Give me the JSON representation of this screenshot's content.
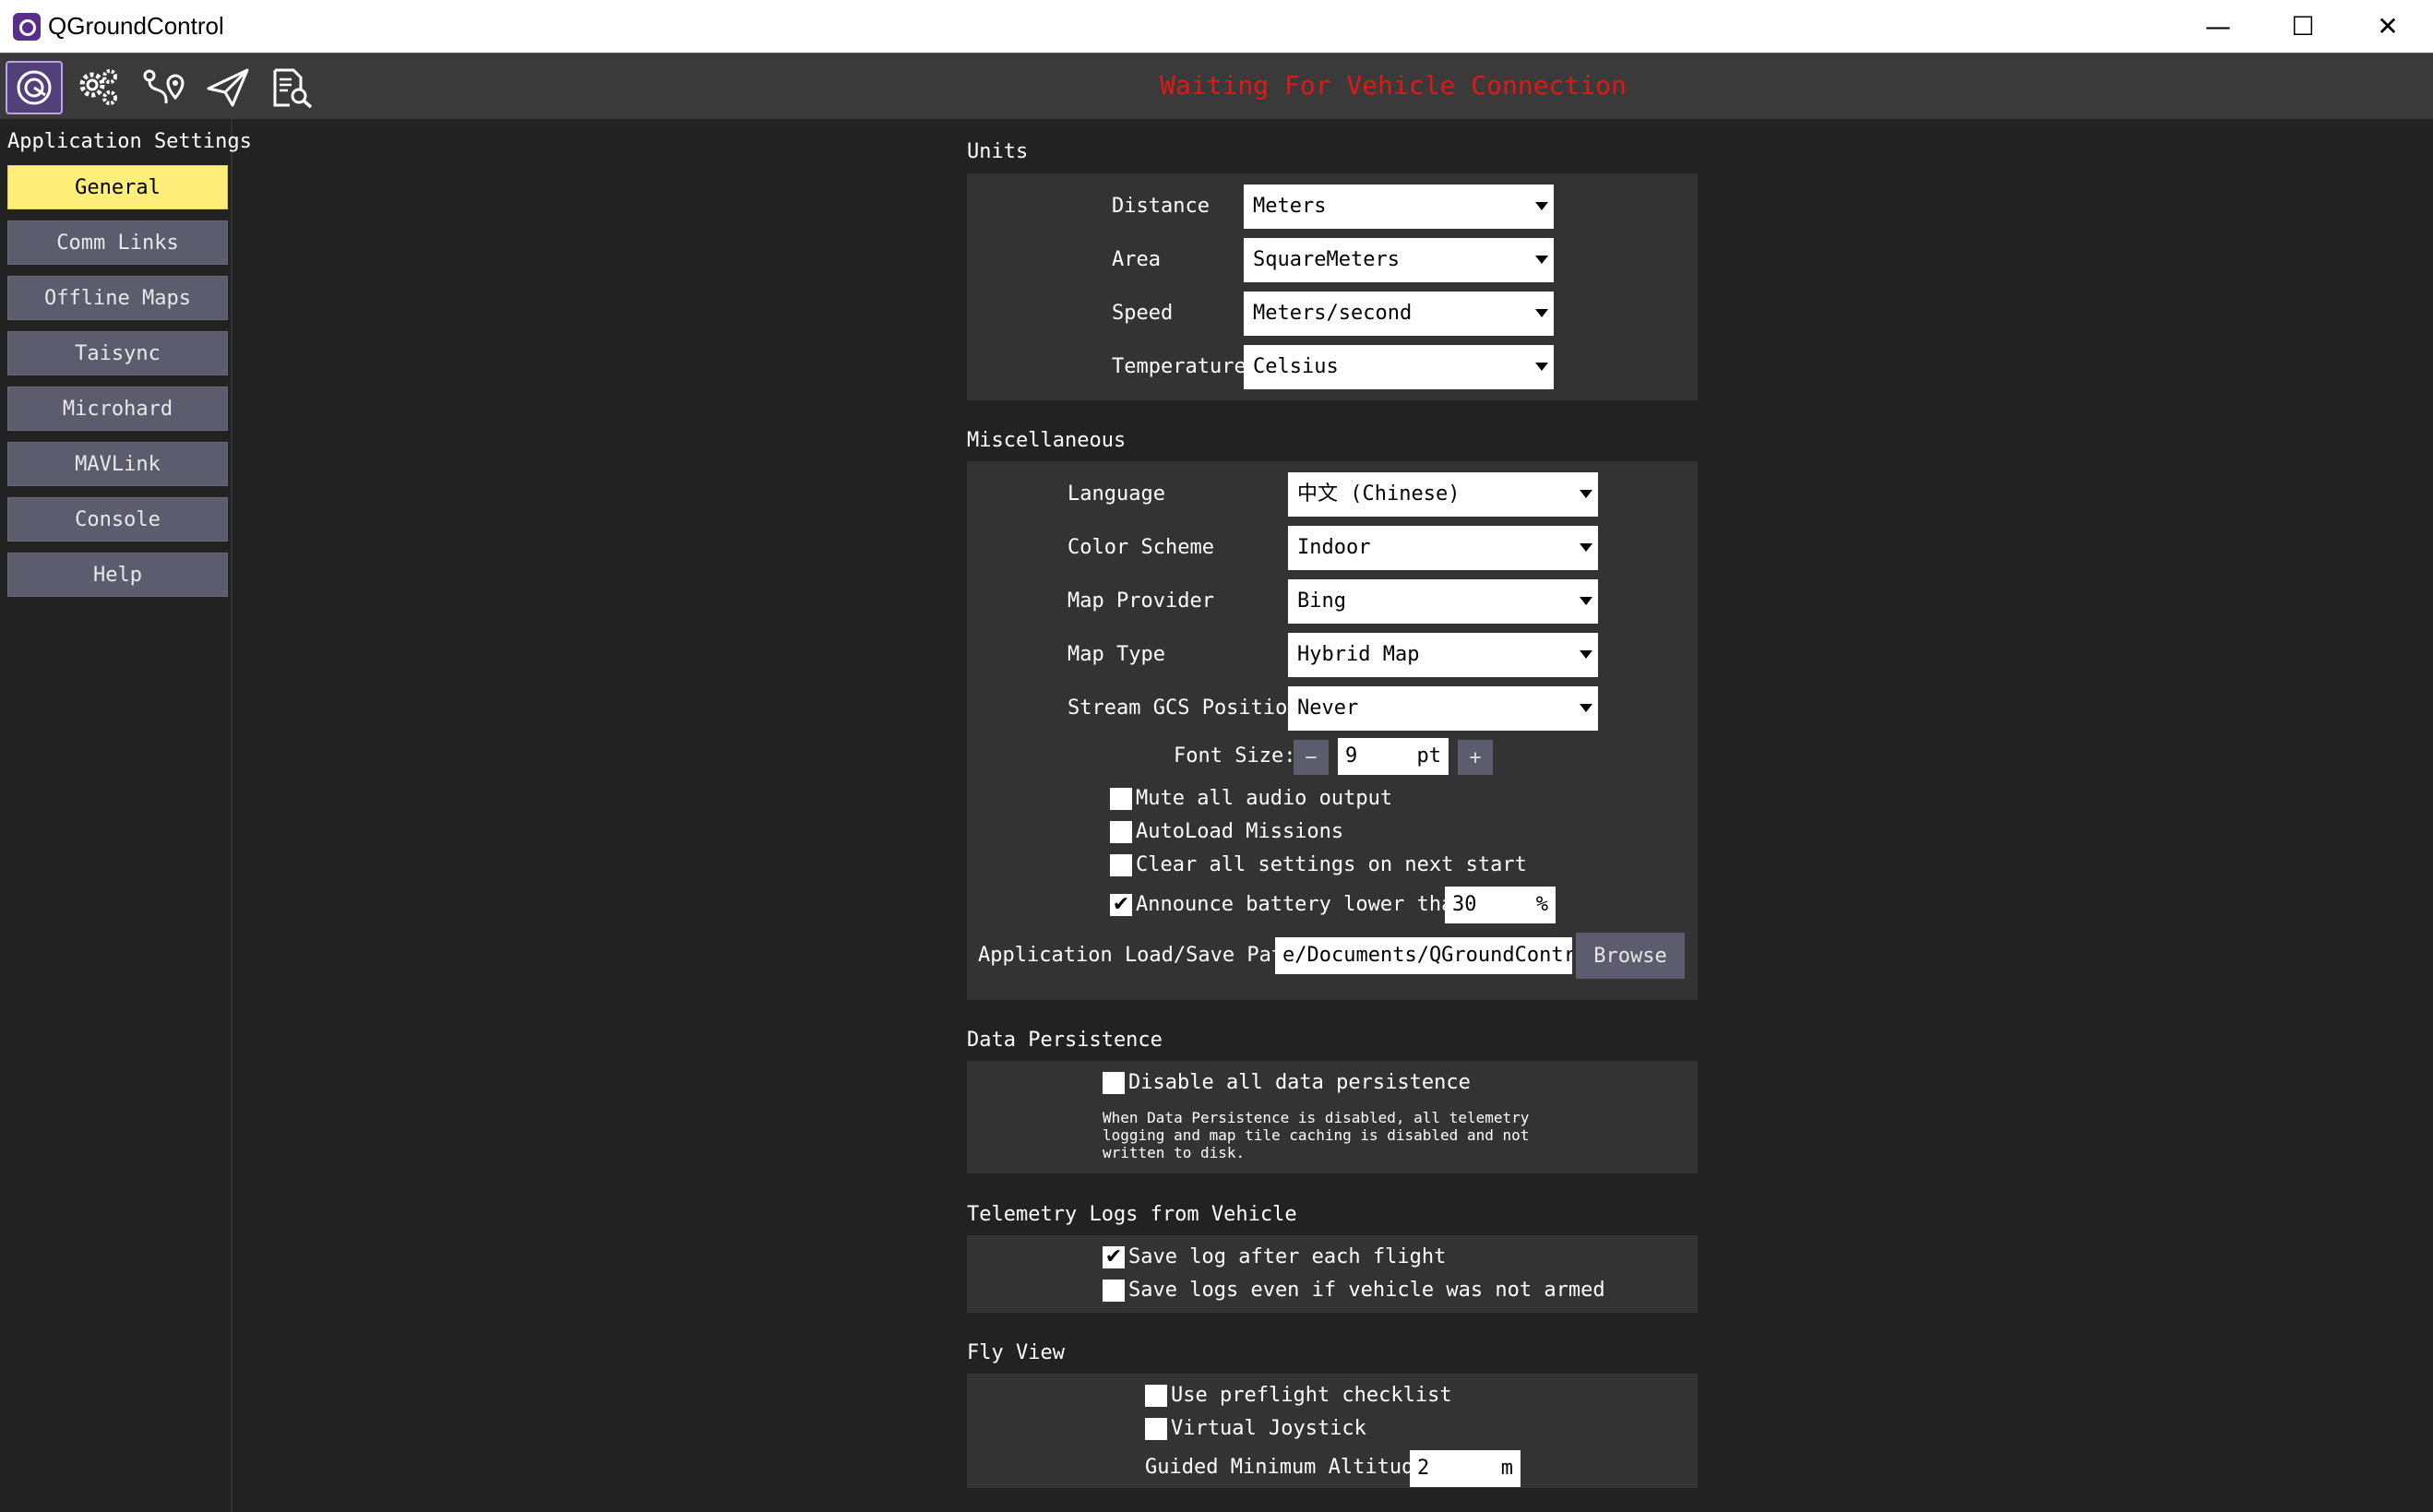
{
  "window": {
    "title": "QGroundControl",
    "minimize": "—",
    "maximize": "☐",
    "close": "✕"
  },
  "toolbar": {
    "status": "Waiting For Vehicle Connection"
  },
  "sidebar": {
    "title": "Application Settings",
    "items": [
      "General",
      "Comm Links",
      "Offline Maps",
      "Taisync",
      "Microhard",
      "MAVLink",
      "Console",
      "Help"
    ]
  },
  "units": {
    "header": "Units",
    "rows": [
      {
        "label": "Distance",
        "value": "Meters"
      },
      {
        "label": "Area",
        "value": "SquareMeters"
      },
      {
        "label": "Speed",
        "value": "Meters/second"
      },
      {
        "label": "Temperature",
        "value": "Celsius"
      }
    ]
  },
  "misc": {
    "header": "Miscellaneous",
    "rows": [
      {
        "label": "Language",
        "value": "中文 (Chinese)"
      },
      {
        "label": "Color Scheme",
        "value": "Indoor"
      },
      {
        "label": "Map Provider",
        "value": "Bing"
      },
      {
        "label": "Map Type",
        "value": "Hybrid Map"
      },
      {
        "label": "Stream GCS Position",
        "value": "Never"
      }
    ],
    "font_size_label": "Font Size:",
    "font_minus": "−",
    "font_value": "9",
    "font_unit": "pt",
    "font_plus": "+",
    "mute_label": "Mute all audio output",
    "autoload_label": "AutoLoad Missions",
    "clear_label": "Clear all settings on next start",
    "announce_label": "Announce battery lower than",
    "announce_value": "30",
    "announce_unit": "%",
    "path_label": "Application Load/Save Path",
    "path_value": "e/Documents/QGroundControl",
    "browse_label": "Browse",
    "check_mark": "✔"
  },
  "persistence": {
    "header": "Data Persistence",
    "disable_label": "Disable all data persistence",
    "help": "When Data Persistence is disabled, all telemetry logging and map tile caching is disabled and not written to disk."
  },
  "telemetry": {
    "header": "Telemetry Logs from Vehicle",
    "save_each_label": "Save log after each flight",
    "save_unarmed_label": "Save logs even if vehicle was not armed"
  },
  "flyview": {
    "header": "Fly View",
    "preflight_label": "Use preflight checklist",
    "joystick_label": "Virtual Joystick",
    "guided_label": "Guided Minimum Altitude",
    "guided_value": "2",
    "guided_unit": "m"
  }
}
